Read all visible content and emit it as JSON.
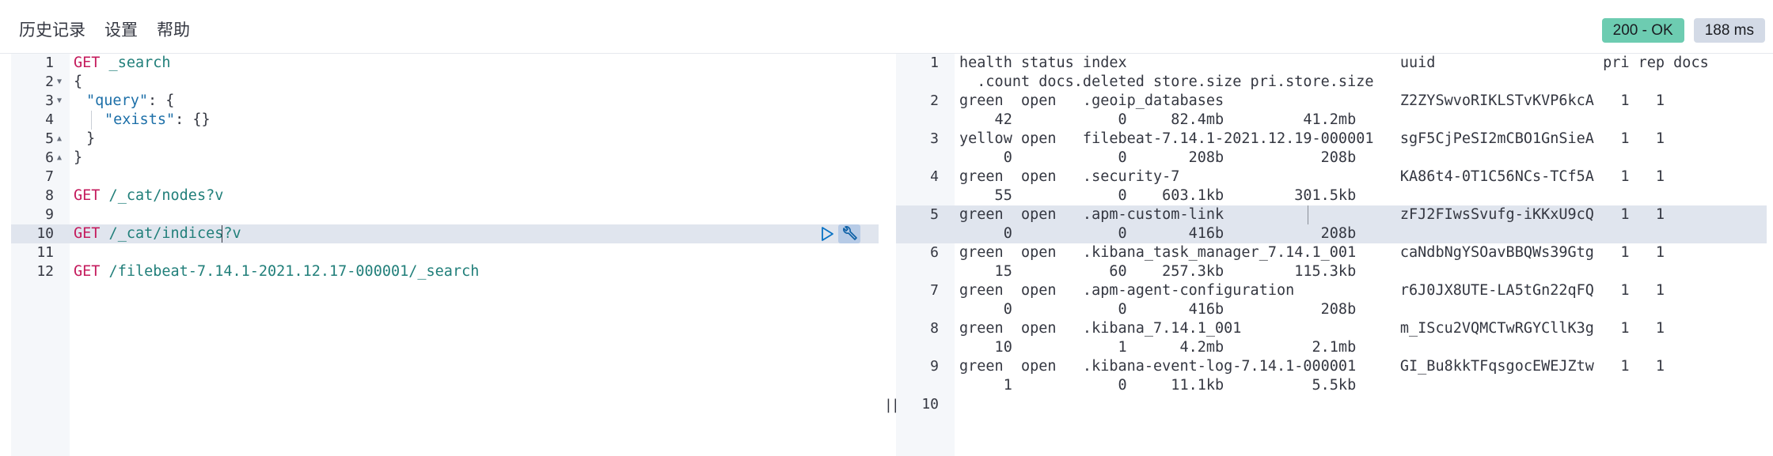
{
  "menu": {
    "history": "历史记录",
    "settings": "设置",
    "help": "帮助"
  },
  "status": {
    "code": "200 - OK",
    "time": "188 ms"
  },
  "colors": {
    "status_ok": "#6dccb1",
    "status_time": "#d3dae6",
    "keyword": "#c41a5c",
    "url": "#217f7a",
    "active_line": "#e0e5ee"
  },
  "editor": {
    "lines": [
      {
        "num": "1",
        "method": "GET",
        "path": " _search"
      },
      {
        "num": "2",
        "text": "{"
      },
      {
        "num": "3",
        "key": "\"query\"",
        "rest": ": {"
      },
      {
        "num": "4",
        "key": "\"exists\"",
        "rest": ": {}"
      },
      {
        "num": "5",
        "text": "}"
      },
      {
        "num": "6",
        "text": "}"
      },
      {
        "num": "7",
        "text": ""
      },
      {
        "num": "8",
        "method": "GET",
        "path": " /_cat/nodes?v"
      },
      {
        "num": "9",
        "text": ""
      },
      {
        "num": "10",
        "method": "GET",
        "path": " /_cat/indices?v"
      },
      {
        "num": "11",
        "text": ""
      },
      {
        "num": "12",
        "method": "GET",
        "path": " /filebeat-7.14.1-2021.12.17-000001/_search"
      }
    ]
  },
  "output": {
    "rows": [
      {
        "num": "1",
        "l1": "health status index                               uuid                   pri rep docs",
        "l2": "  .count docs.deleted store.size pri.store.size"
      },
      {
        "num": "2",
        "l1": "green  open   .geoip_databases                    Z2ZYSwvoRIKLSTvKVP6kcA   1   1",
        "l2": "    42            0     82.4mb         41.2mb"
      },
      {
        "num": "3",
        "l1": "yellow open   filebeat-7.14.1-2021.12.19-000001   sgF5CjPeSI2mCBO1GnSieA   1   1",
        "l2": "     0            0       208b           208b"
      },
      {
        "num": "4",
        "l1": "green  open   .security-7                         KA86t4-0T1C56NCs-TCf5A   1   1",
        "l2": "    55            0    603.1kb        301.5kb"
      },
      {
        "num": "5",
        "l1": "green  open   .apm-custom-link                    zFJ2FIwsSvufg-iKKxU9cQ   1   1",
        "l2": "     0            0       416b           208b"
      },
      {
        "num": "6",
        "l1": "green  open   .kibana_task_manager_7.14.1_001     caNdbNgYSOavBBQWs39Gtg   1   1",
        "l2": "    15           60    257.3kb        115.3kb"
      },
      {
        "num": "7",
        "l1": "green  open   .apm-agent-configuration            r6J0JX8UTE-LA5tGn22qFQ   1   1",
        "l2": "     0            0       416b           208b"
      },
      {
        "num": "8",
        "l1": "green  open   .kibana_7.14.1_001                  m_IScu2VQMCTwRGYCllK3g   1   1",
        "l2": "    10            1      4.2mb          2.1mb"
      },
      {
        "num": "9",
        "l1": "green  open   .kibana-event-log-7.14.1-000001     GI_Bu8kkTFqsgocEWEJZtw   1   1",
        "l2": "     1            0     11.1kb          5.5kb"
      },
      {
        "num": "10",
        "l1": "",
        "l2": ""
      }
    ]
  }
}
